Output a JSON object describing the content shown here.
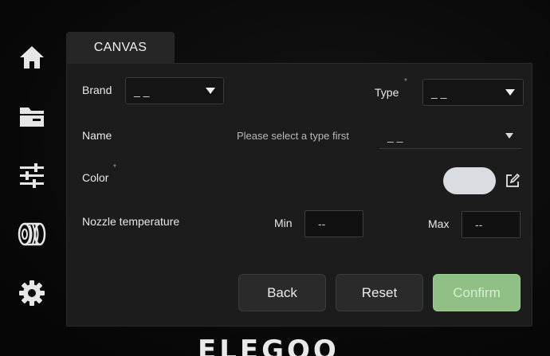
{
  "sidebar": {
    "items": [
      {
        "icon": "home-icon",
        "label": "Home"
      },
      {
        "icon": "folder-icon",
        "label": "Files"
      },
      {
        "icon": "sliders-icon",
        "label": "Controls"
      },
      {
        "icon": "filament-spool-icon",
        "label": "Filament"
      },
      {
        "icon": "gear-icon",
        "label": "Settings"
      }
    ]
  },
  "tab": {
    "label": "CANVAS"
  },
  "form": {
    "brand": {
      "label": "Brand",
      "value": "_ _"
    },
    "type": {
      "label": "Type",
      "required_mark": "*",
      "value": "_ _"
    },
    "name": {
      "label": "Name",
      "hint": "Please select a type first",
      "value": "_ _"
    },
    "color": {
      "label": "Color",
      "required_mark": "*",
      "swatch": "#d9dde2"
    },
    "nozzle": {
      "label": "Nozzle temperature",
      "min_label": "Min",
      "min_value": "--",
      "max_label": "Max",
      "max_value": "--"
    }
  },
  "buttons": {
    "back": "Back",
    "reset": "Reset",
    "confirm": "Confirm"
  },
  "brand_logo": "ELEGOO",
  "colors": {
    "confirm": "#8fbf84",
    "panel": "#1c1c1c",
    "background": "#050505"
  }
}
